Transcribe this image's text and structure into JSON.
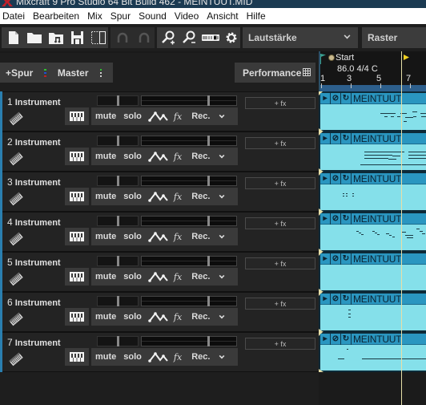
{
  "window": {
    "title": "Mixcraft 9 Pro Studio 64 Bit Build 462 - MEINTUUT.MID"
  },
  "menu": [
    "Datei",
    "Bearbeiten",
    "Mix",
    "Spur",
    "Sound",
    "Video",
    "Ansicht",
    "Hilfe"
  ],
  "toolbar": {
    "file_buttons": [
      "new-file-icon",
      "open-folder-icon",
      "open-music-folder-icon",
      "save-icon",
      "crop-icon"
    ],
    "history_buttons": [
      "undo-icon",
      "redo-icon"
    ],
    "view_buttons": [
      "zoom-in-icon",
      "zoom-out-icon",
      "midi-icon",
      "settings-gear-icon"
    ],
    "automation_select": "Lautstärke",
    "grid_select": "Raster"
  },
  "header": {
    "add_track": "+Spur",
    "master": "Master",
    "performance": "Performance"
  },
  "ruler": {
    "marker": "Start",
    "tempo_signature": "86.0 4/4 C",
    "bar_labels": [
      "1",
      "3",
      "5",
      "7"
    ]
  },
  "track_controls": {
    "mute": "mute",
    "solo": "solo",
    "fx": "fx",
    "rec": "Rec.",
    "add_fx": "+ fx"
  },
  "tracks": [
    {
      "number": "1",
      "name": "Instrument",
      "clip": "MEINTUUT"
    },
    {
      "number": "2",
      "name": "Instrument",
      "clip": "MEINTUUT"
    },
    {
      "number": "3",
      "name": "Instrument",
      "clip": "MEINTUUT"
    },
    {
      "number": "4",
      "name": "Instrument",
      "clip": "MEINTUUT"
    },
    {
      "number": "5",
      "name": "Instrument",
      "clip": "MEINTUUT"
    },
    {
      "number": "6",
      "name": "Instrument",
      "clip": "MEINTUUT"
    },
    {
      "number": "7",
      "name": "Instrument",
      "clip": "MEINTUUT"
    }
  ],
  "colors": {
    "track_accent": "#2a7fb0",
    "clip_body": "#85e0ea",
    "clip_header": "#2a96c0",
    "playhead": "#e7dfa8",
    "end_marker": "#f0d020",
    "start_marker": "#3aa090"
  }
}
